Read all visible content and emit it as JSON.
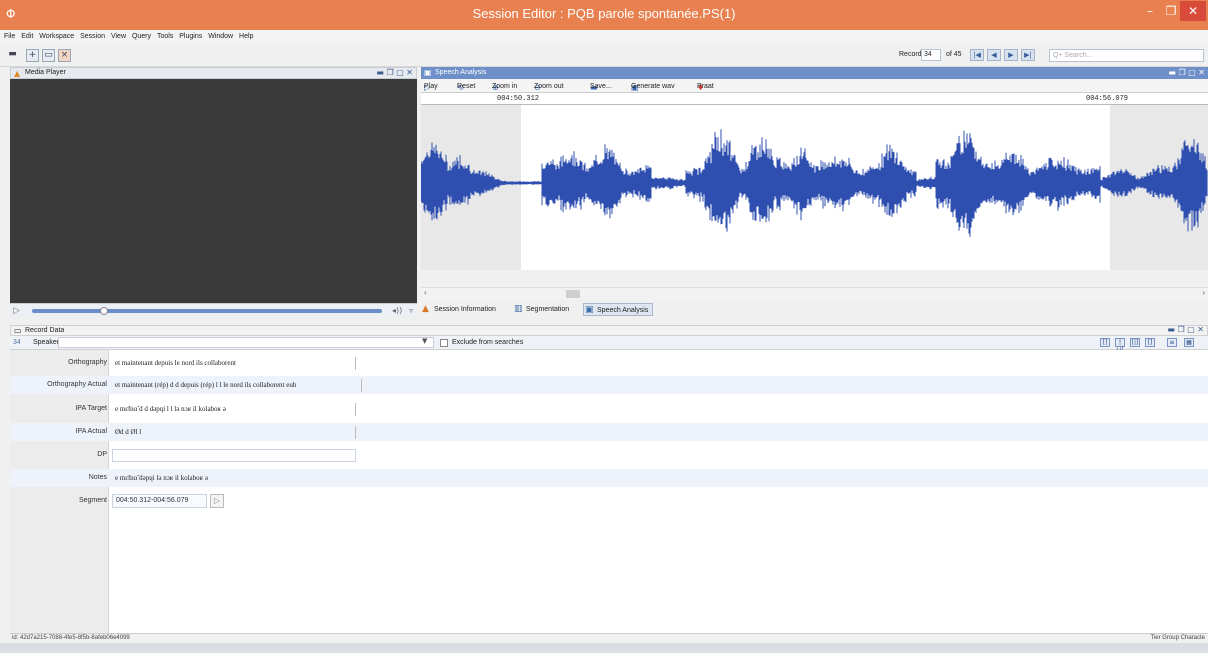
{
  "window": {
    "title": "Session Editor : PQB parole spontanée.PS(1)",
    "min": "–",
    "max": "❐",
    "close": "✕",
    "icon": "Φ"
  },
  "menu": [
    "File",
    "Edit",
    "Workspace",
    "Session",
    "View",
    "Query",
    "Tools",
    "Plugins",
    "Window",
    "Help"
  ],
  "toolbar": {
    "record_label": "Record",
    "record_value": "34",
    "record_of": "of 45",
    "search_placeholder": "Q+ Search..."
  },
  "media_player": {
    "title": "Media Player"
  },
  "speech_analysis": {
    "title": "Speech Analysis",
    "play": "Play",
    "reset": "Reset",
    "zoom_in": "Zoom in",
    "zoom_out": "Zoom out",
    "save": "Save...",
    "generate_wav": "Generate wav",
    "praat": "Praat",
    "time_start": "004:50.312",
    "time_end": "004:56.079"
  },
  "tabs": [
    "Session Information",
    "Segmentation",
    "Speech Analysis"
  ],
  "record_data": {
    "title": "Record Data",
    "record_number": "34",
    "speaker_label": "Speaker:",
    "exclude_label": "Exclude from searches",
    "tiers": [
      {
        "label": "Orthography",
        "value": "et maintenant depuis le nord ils collaborent"
      },
      {
        "label": "Orthography Actual",
        "value": "et maintenant (rép) d d depuis (rép) l l le nord ils collaborent euh"
      },
      {
        "label": "IPA Target",
        "value": "e mɛ̃tnɑ̃ d d dəpɥi l l lə nɔʁ il kolaboʁ ə"
      },
      {
        "label": "IPA Actual",
        "value": "Ød d Øl l"
      },
      {
        "label": "DP",
        "value": ""
      },
      {
        "label": "Notes",
        "value": "e mɛ̃tnɑ̃ dəpɥi lə nɔʁ il kolaboʁ ə"
      },
      {
        "label": "Segment",
        "value": "004:50.312-004:56.079"
      }
    ]
  },
  "status": {
    "uuid": "id: 42d7a215-7088-4fe5-8f5b-8afeb06e4099",
    "right": "Tier  Group  Characte"
  },
  "colors": {
    "titlebar": "#e9804f",
    "accent": "#6e8fc8",
    "waveform": "#2e4fb0"
  }
}
